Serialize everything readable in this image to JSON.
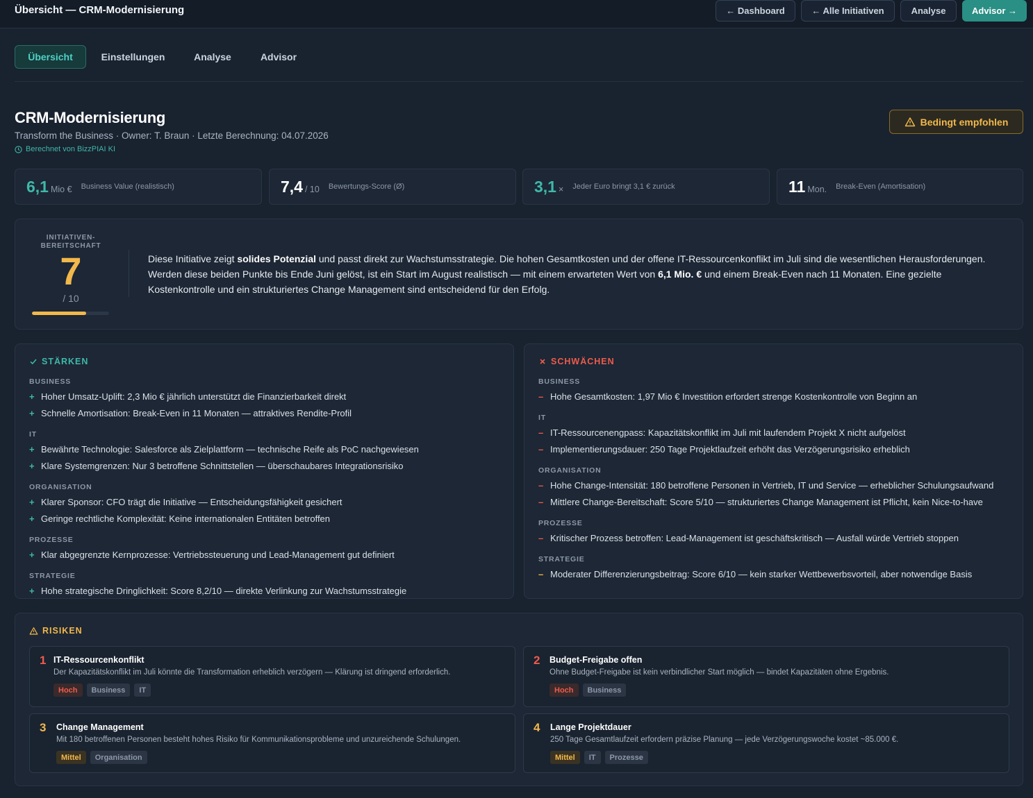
{
  "topbar": {
    "title": "Übersicht — CRM-Modernisierung",
    "buttons": [
      "← Dashboard",
      "← Alle Initiativen",
      "Analyse",
      "Advisor →"
    ]
  },
  "tabs": [
    "Übersicht",
    "Einstellungen",
    "Analyse",
    "Advisor"
  ],
  "header": {
    "title": "CRM-Modernisierung",
    "subtitle": "Transform the Business · Owner: T. Braun · Letzte Berechnung: 04.07.2026",
    "computed": "Berechnet von BizzPIAI KI",
    "recommendation": "Bedingt empfohlen"
  },
  "kpis": [
    {
      "value": "6,1",
      "unit": "Mio €",
      "label": "Business Value (realistisch)",
      "color": "#3fb8a9"
    },
    {
      "value": "7,4",
      "unit": "/ 10",
      "label": "Bewertungs-Score (Ø)",
      "color": "#ffffff"
    },
    {
      "value": "3,1",
      "unit": "×",
      "label": "Jeder Euro bringt 3,1 € zurück",
      "color": "#3fb8a9"
    },
    {
      "value": "11",
      "unit": "Mon.",
      "label": "Break-Even (Amortisation)",
      "color": "#ffffff"
    }
  ],
  "readiness": {
    "label": "INITIATIVEN-BEREITSCHAFT",
    "score": "7",
    "denominator": "/ 10",
    "progress": 0.7,
    "text_parts": {
      "p1": "Diese Initiative zeigt ",
      "b1": "solides Potenzial",
      "p2": " und passt direkt zur Wachstumsstrategie. Die hohen Gesamtkosten und der offene IT-Ressourcenkonflikt im Juli sind die wesentlichen Herausforderungen. Werden diese beiden Punkte bis Ende Juni gelöst, ist ein Start im August realistisch — mit einem erwarteten Wert von ",
      "b2": "6,1 Mio. €",
      "p3": " und einem Break-Even nach 11 Monaten. Eine gezielte Kostenkontrolle und ein strukturiertes Change Management sind entscheidend für den Erfolg."
    }
  },
  "strengths": {
    "title": "STÄRKEN",
    "groups": [
      {
        "cat": "BUSINESS",
        "items": [
          "Hoher Umsatz-Uplift: 2,3 Mio € jährlich unterstützt die Finanzierbarkeit direkt",
          "Schnelle Amortisation: Break-Even in 11 Monaten — attraktives Rendite-Profil"
        ]
      },
      {
        "cat": "IT",
        "items": [
          "Bewährte Technologie: Salesforce als Zielplattform — technische Reife als PoC nachgewiesen",
          "Klare Systemgrenzen: Nur 3 betroffene Schnittstellen — überschaubares Integrationsrisiko"
        ]
      },
      {
        "cat": "ORGANISATION",
        "items": [
          "Klarer Sponsor: CFO trägt die Initiative — Entscheidungsfähigkeit gesichert",
          "Geringe rechtliche Komplexität: Keine internationalen Entitäten betroffen"
        ]
      },
      {
        "cat": "PROZESSE",
        "items": [
          "Klar abgegrenzte Kernprozesse: Vertriebssteuerung und Lead-Management gut definiert"
        ]
      },
      {
        "cat": "STRATEGIE",
        "items": [
          "Hohe strategische Dringlichkeit: Score 8,2/10 — direkte Verlinkung zur Wachstumsstrategie"
        ]
      }
    ]
  },
  "weaknesses": {
    "title": "SCHWÄCHEN",
    "groups": [
      {
        "cat": "BUSINESS",
        "items": [
          "Hohe Gesamtkosten: 1,97 Mio € Investition erfordert strenge Kostenkontrolle von Beginn an"
        ]
      },
      {
        "cat": "IT",
        "items": [
          "IT-Ressourcenengpass: Kapazitätskonflikt im Juli mit laufendem Projekt X nicht aufgelöst",
          "Implementierungsdauer: 250 Tage Projektlaufzeit erhöht das Verzögerungsrisiko erheblich"
        ]
      },
      {
        "cat": "ORGANISATION",
        "items": [
          "Hohe Change-Intensität: 180 betroffene Personen in Vertrieb, IT und Service — erheblicher Schulungsaufwand",
          "Mittlere Change-Bereitschaft: Score 5/10 — strukturiertes Change Management ist Pflicht, kein Nice-to-have"
        ]
      },
      {
        "cat": "PROZESSE",
        "items": [
          "Kritischer Prozess betroffen: Lead-Management ist geschäftskritisch — Ausfall würde Vertrieb stoppen"
        ]
      },
      {
        "cat": "STRATEGIE",
        "items": [
          "Moderater Differenzierungsbeitrag: Score 6/10 — kein starker Wettbewerbsvorteil, aber notwendige Basis"
        ]
      }
    ]
  },
  "risks": {
    "title": "RISIKEN",
    "items": [
      {
        "num": "1",
        "title": "IT-Ressourcenkonflikt",
        "desc": "Der Kapazitätskonflikt im Juli könnte die Transformation erheblich verzögern — Klärung ist dringend erforderlich.",
        "tags": [
          {
            "text": "Hoch",
            "level": "high"
          },
          {
            "text": "Business",
            "level": "none"
          },
          {
            "text": "IT",
            "level": "none"
          }
        ],
        "color": "#ef5b4c"
      },
      {
        "num": "2",
        "title": "Budget-Freigabe offen",
        "desc": "Ohne Budget-Freigabe ist kein verbindlicher Start möglich — bindet Kapazitäten ohne Ergebnis.",
        "tags": [
          {
            "text": "Hoch",
            "level": "high"
          },
          {
            "text": "Business",
            "level": "none"
          }
        ],
        "color": "#ef5b4c"
      },
      {
        "num": "3",
        "title": "Change Management",
        "desc": "Mit 180 betroffenen Personen besteht hohes Risiko für Kommunikationsprobleme und unzureichende Schulungen.",
        "tags": [
          {
            "text": "Mittel",
            "level": "mid"
          },
          {
            "text": "Organisation",
            "level": "none"
          }
        ],
        "color": "#f2b84b"
      },
      {
        "num": "4",
        "title": "Lange Projektdauer",
        "desc": "250 Tage Gesamtlaufzeit erfordern präzise Planung — jede Verzögerungswoche kostet ~85.000 €.",
        "tags": [
          {
            "text": "Mittel",
            "level": "mid"
          },
          {
            "text": "IT",
            "level": "none"
          },
          {
            "text": "Prozesse",
            "level": "none"
          }
        ],
        "color": "#f2b84b"
      }
    ]
  }
}
